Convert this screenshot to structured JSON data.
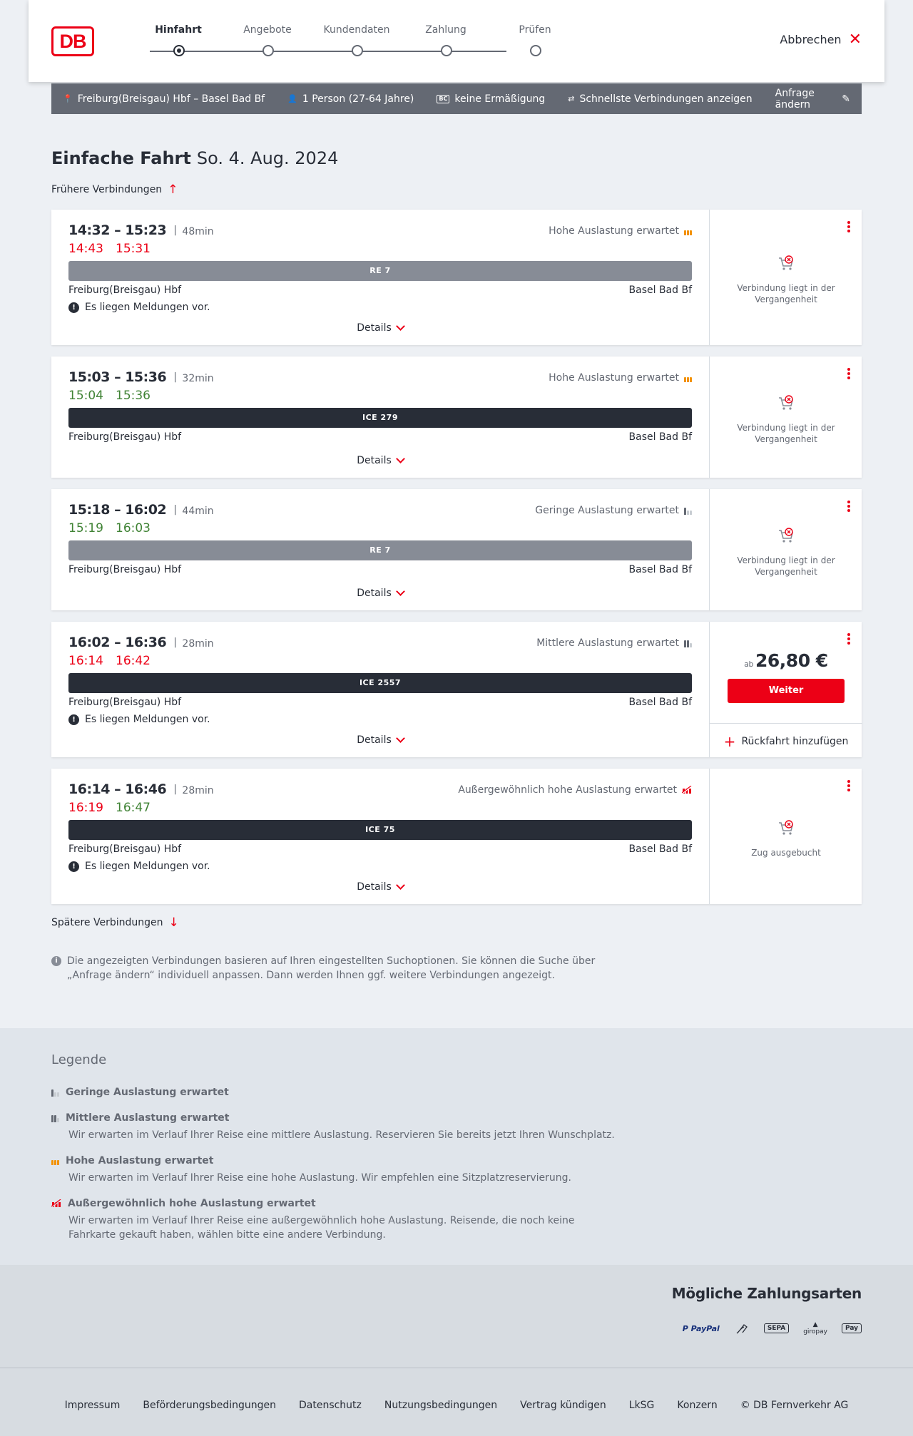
{
  "header": {
    "logo": "DB",
    "steps": [
      {
        "label": "Hinfahrt",
        "active": true
      },
      {
        "label": "Angebote",
        "active": false
      },
      {
        "label": "Kundendaten",
        "active": false
      },
      {
        "label": "Zahlung",
        "active": false
      },
      {
        "label": "Prüfen",
        "active": false
      }
    ],
    "cancel_label": "Abbrechen"
  },
  "search": {
    "route": "Freiburg(Breisgau) Hbf – Basel Bad Bf",
    "passengers": "1 Person (27-64 Jahre)",
    "discount_badge": "BC",
    "discount": "keine Ermäßigung",
    "option": "Schnellste Verbindungen anzeigen",
    "change_label": "Anfrage ändern"
  },
  "title": {
    "type": "Einfache Fahrt",
    "date": "So. 4. Aug. 2024"
  },
  "earlier_label": "Frühere Verbindungen",
  "later_label": "Spätere Verbindungen",
  "connections": [
    {
      "times": "14:32 – 15:23",
      "duration": "48min",
      "rt_dep": "14:43",
      "rt_dep_color": "red",
      "rt_arr": "15:31",
      "rt_arr_color": "red",
      "load": "Hohe Auslastung erwartet",
      "load_level": "high",
      "train": "RE 7",
      "train_type": "re",
      "from": "Freiburg(Breisgau) Hbf",
      "to": "Basel Bad Bf",
      "message": "Es liegen Meldungen vor.",
      "details": "Details",
      "status": "Verbindung liegt in der Vergangenheit"
    },
    {
      "times": "15:03 – 15:36",
      "duration": "32min",
      "rt_dep": "15:04",
      "rt_dep_color": "green",
      "rt_arr": "15:36",
      "rt_arr_color": "green",
      "load": "Hohe Auslastung erwartet",
      "load_level": "high",
      "train": "ICE 279",
      "train_type": "ice",
      "from": "Freiburg(Breisgau) Hbf",
      "to": "Basel Bad Bf",
      "message": "",
      "details": "Details",
      "status": "Verbindung liegt in der Vergangenheit"
    },
    {
      "times": "15:18 – 16:02",
      "duration": "44min",
      "rt_dep": "15:19",
      "rt_dep_color": "green",
      "rt_arr": "16:03",
      "rt_arr_color": "green",
      "load": "Geringe Auslastung erwartet",
      "load_level": "low",
      "train": "RE 7",
      "train_type": "re",
      "from": "Freiburg(Breisgau) Hbf",
      "to": "Basel Bad Bf",
      "message": "",
      "details": "Details",
      "status": "Verbindung liegt in der Vergangenheit"
    },
    {
      "times": "16:02 – 16:36",
      "duration": "28min",
      "rt_dep": "16:14",
      "rt_dep_color": "red",
      "rt_arr": "16:42",
      "rt_arr_color": "red",
      "load": "Mittlere Auslastung erwartet",
      "load_level": "medium",
      "train": "ICE 2557",
      "train_type": "ice",
      "from": "Freiburg(Breisgau) Hbf",
      "to": "Basel Bad Bf",
      "message": "Es liegen Meldungen vor.",
      "details": "Details",
      "price_prefix": "ab",
      "price": "26,80 €",
      "button": "Weiter",
      "return_label": "Rückfahrt hinzufügen"
    },
    {
      "times": "16:14 – 16:46",
      "duration": "28min",
      "rt_dep": "16:19",
      "rt_dep_color": "red",
      "rt_arr": "16:47",
      "rt_arr_color": "green",
      "load": "Außergewöhnlich hohe Auslastung erwartet",
      "load_level": "extreme",
      "train": "ICE 75",
      "train_type": "ice",
      "from": "Freiburg(Breisgau) Hbf",
      "to": "Basel Bad Bf",
      "message": "Es liegen Meldungen vor.",
      "details": "Details",
      "status": "Zug ausgebucht"
    }
  ],
  "note": "Die angezeigten Verbindungen basieren auf Ihren eingestellten Suchoptionen. Sie können die Suche über „Anfrage ändern“ individuell anpassen. Dann werden Ihnen ggf. weitere Verbindungen angezeigt.",
  "legend": {
    "title": "Legende",
    "items": [
      {
        "level": "low",
        "title": "Geringe Auslastung erwartet",
        "desc": ""
      },
      {
        "level": "medium",
        "title": "Mittlere Auslastung erwartet",
        "desc": "Wir erwarten im Verlauf Ihrer Reise eine mittlere Auslastung. Reservieren Sie bereits jetzt Ihren Wunschplatz."
      },
      {
        "level": "high",
        "title": "Hohe Auslastung erwartet",
        "desc": "Wir erwarten im Verlauf Ihrer Reise eine hohe Auslastung. Wir empfehlen eine Sitzplatzreservierung."
      },
      {
        "level": "extreme",
        "title": "Außergewöhnlich hohe Auslastung erwartet",
        "desc": "Wir erwarten im Verlauf Ihrer Reise eine außergewöhnlich hohe Auslastung. Reisende, die noch keine Fahrkarte gekauft haben, wählen bitte eine andere Verbindung."
      }
    ]
  },
  "payment": {
    "title": "Mögliche Zahlungsarten",
    "methods": [
      {
        "icon": "paypal-icon",
        "label": "P PayPal"
      },
      {
        "icon": "direct-debit-icon",
        "label": ""
      },
      {
        "icon": "sepa-icon",
        "label": "SEPA"
      },
      {
        "icon": "giropay-icon",
        "label": "giropay"
      },
      {
        "icon": "applepay-icon",
        "label": "Pay"
      }
    ]
  },
  "footer": {
    "links": [
      "Impressum",
      "Beförderungsbedingungen",
      "Datenschutz",
      "Nutzungsbedingungen",
      "Vertrag kündigen",
      "LkSG",
      "Konzern",
      "© DB Fernverkehr AG"
    ]
  },
  "colors": {
    "brand": "#ec0016",
    "delay": "#ec0016",
    "ontime": "#408335",
    "high_load": "#f39200",
    "text": "#282d37"
  }
}
